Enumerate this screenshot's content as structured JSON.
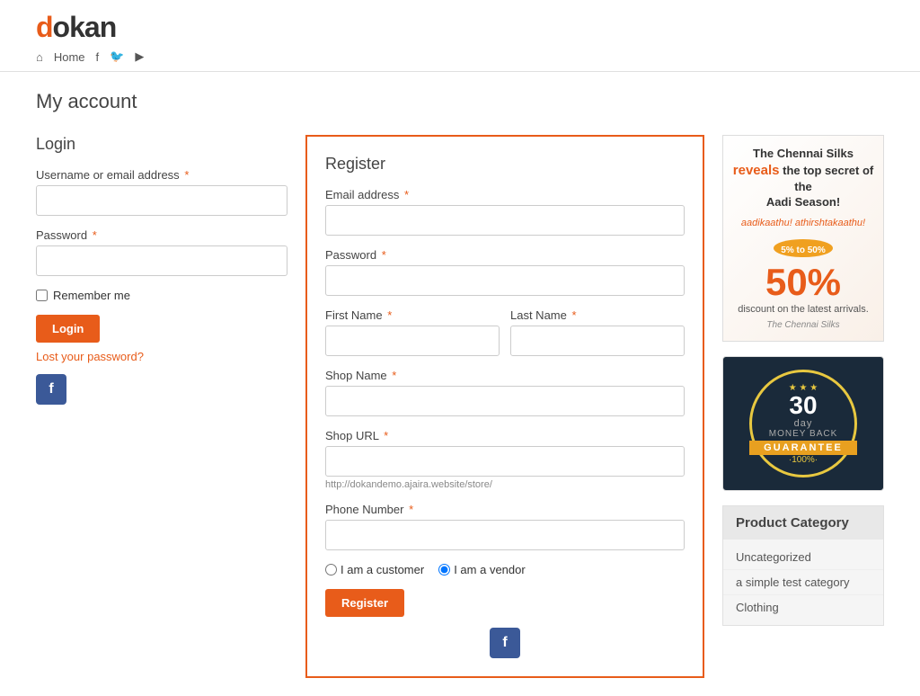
{
  "header": {
    "logo": "dokan",
    "nav": {
      "home_label": "Home",
      "home_icon": "⌂"
    }
  },
  "page": {
    "title": "My account"
  },
  "login": {
    "section_title": "Login",
    "username_label": "Username or email address",
    "password_label": "Password",
    "remember_label": "Remember me",
    "login_button": "Login",
    "lost_password": "Lost your password?"
  },
  "register": {
    "section_title": "Register",
    "email_label": "Email address",
    "password_label": "Password",
    "first_name_label": "First Name",
    "last_name_label": "Last Name",
    "shop_name_label": "Shop Name",
    "shop_url_label": "Shop URL",
    "shop_url_hint": "http://dokandemo.ajaira.website/store/",
    "phone_label": "Phone Number",
    "customer_label": "I am a customer",
    "vendor_label": "I am a vendor",
    "register_button": "Register"
  },
  "sidebar": {
    "ad": {
      "title_line1": "The Chennai Silks",
      "title_line2": "reveals",
      "title_line3": "the top secret of the",
      "title_line4": "Aadi Season!",
      "discount": "50%",
      "discount_text": "discount on the latest arrivals.",
      "brand": "The Chennai Silks"
    },
    "guarantee": {
      "days": "30",
      "day_label": "day",
      "money_back": "MONEY BACK",
      "ribbon": "GUARANTEE",
      "percent": "·100%·",
      "stars": "★ ★ ★"
    },
    "product_category": {
      "title": "Product Category",
      "items": [
        {
          "label": "Uncategorized"
        },
        {
          "label": "a simple test category"
        },
        {
          "label": "Clothing"
        }
      ]
    }
  }
}
